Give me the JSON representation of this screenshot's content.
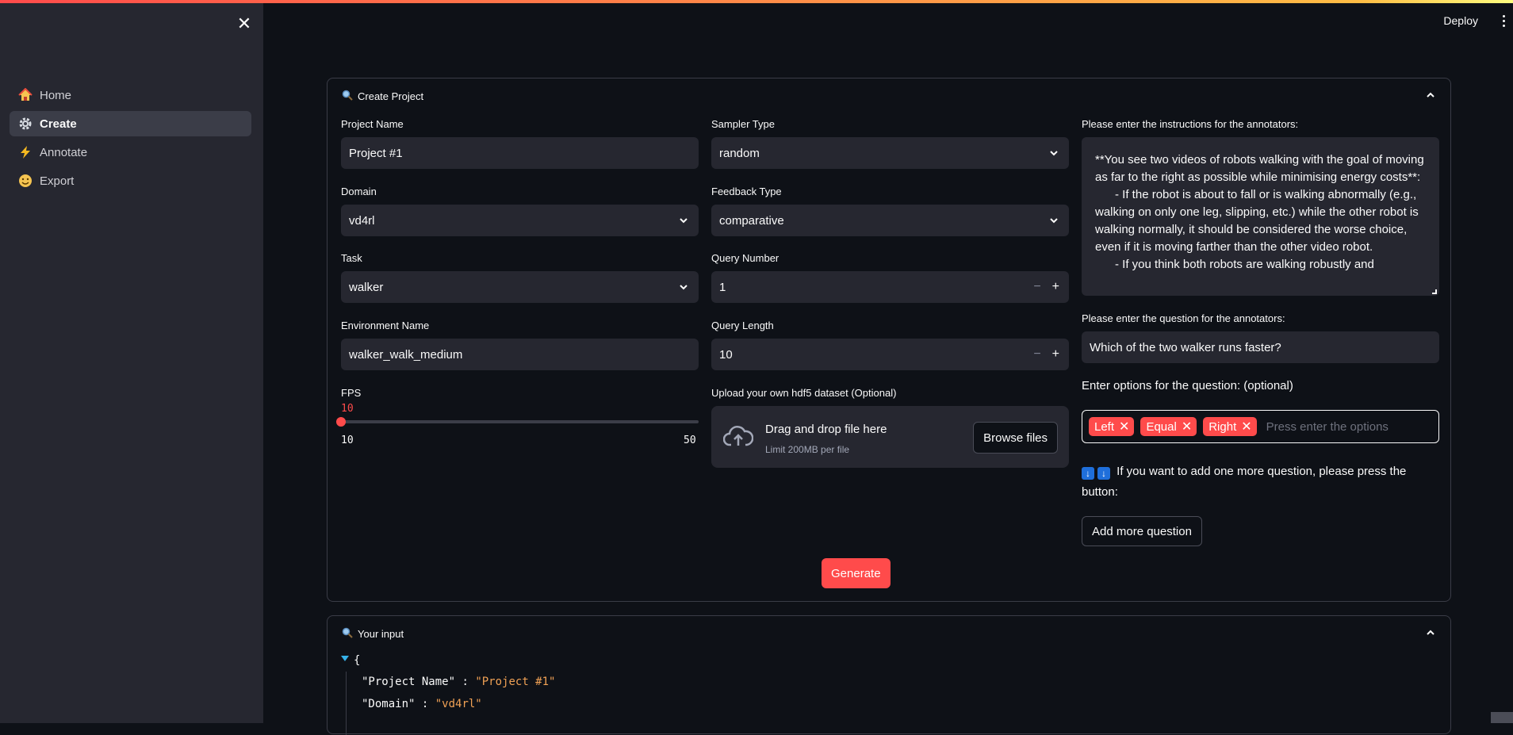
{
  "header": {
    "deploy_label": "Deploy"
  },
  "sidebar": {
    "items": [
      {
        "label": "Home",
        "icon": "house-icon",
        "active": false
      },
      {
        "label": "Create",
        "icon": "gear-icon",
        "active": true
      },
      {
        "label": "Annotate",
        "icon": "lightning-icon",
        "active": false
      },
      {
        "label": "Export",
        "icon": "smiley-icon",
        "active": false
      }
    ]
  },
  "create_project": {
    "title": "Create Project",
    "project_name": {
      "label": "Project Name",
      "value": "Project #1"
    },
    "domain": {
      "label": "Domain",
      "value": "vd4rl"
    },
    "task": {
      "label": "Task",
      "value": "walker"
    },
    "environment_name": {
      "label": "Environment Name",
      "value": "walker_walk_medium"
    },
    "fps": {
      "label": "FPS",
      "value": "10",
      "min": "10",
      "max": "50",
      "fraction": 0
    },
    "sampler_type": {
      "label": "Sampler Type",
      "value": "random"
    },
    "feedback_type": {
      "label": "Feedback Type",
      "value": "comparative"
    },
    "query_number": {
      "label": "Query Number",
      "value": "1"
    },
    "query_length": {
      "label": "Query Length",
      "value": "10"
    },
    "upload": {
      "label": "Upload your own hdf5 dataset (Optional)",
      "main_text": "Drag and drop file here",
      "sub_text": "Limit 200MB per file",
      "browse_label": "Browse files"
    },
    "instructions": {
      "label": "Please enter the instructions for the annotators:",
      "value": "**You see two videos of robots walking with the goal of moving as far to the right as possible while minimising energy costs**:\n      - If the robot is about to fall or is walking abnormally (e.g., walking on only one leg, slipping, etc.) while the other robot is walking normally, it should be considered the worse choice, even if it is moving farther than the other video robot.\n      - If you think both robots are walking robustly and"
    },
    "question": {
      "label": "Please enter the question for the annotators:",
      "value": "Which of the two walker runs faster?"
    },
    "options": {
      "label": "Enter options for the question: (optional)",
      "tags": [
        "Left",
        "Equal",
        "Right"
      ],
      "placeholder": "Press enter the options"
    },
    "add_more_text": "If you want to add one more question, please press the button:",
    "add_more_button": "Add more question",
    "generate_button": "Generate"
  },
  "your_input": {
    "title": "Your input",
    "json_open": "{",
    "entries": [
      {
        "key": "\"Project Name\"",
        "value": "\"Project #1\""
      },
      {
        "key": "\"Domain\"",
        "value": "\"vd4rl\""
      }
    ]
  },
  "colors": {
    "accent": "#ff4b4b",
    "background": "#0e1117",
    "sidebar": "#262730",
    "json_string": "#f0a155"
  }
}
